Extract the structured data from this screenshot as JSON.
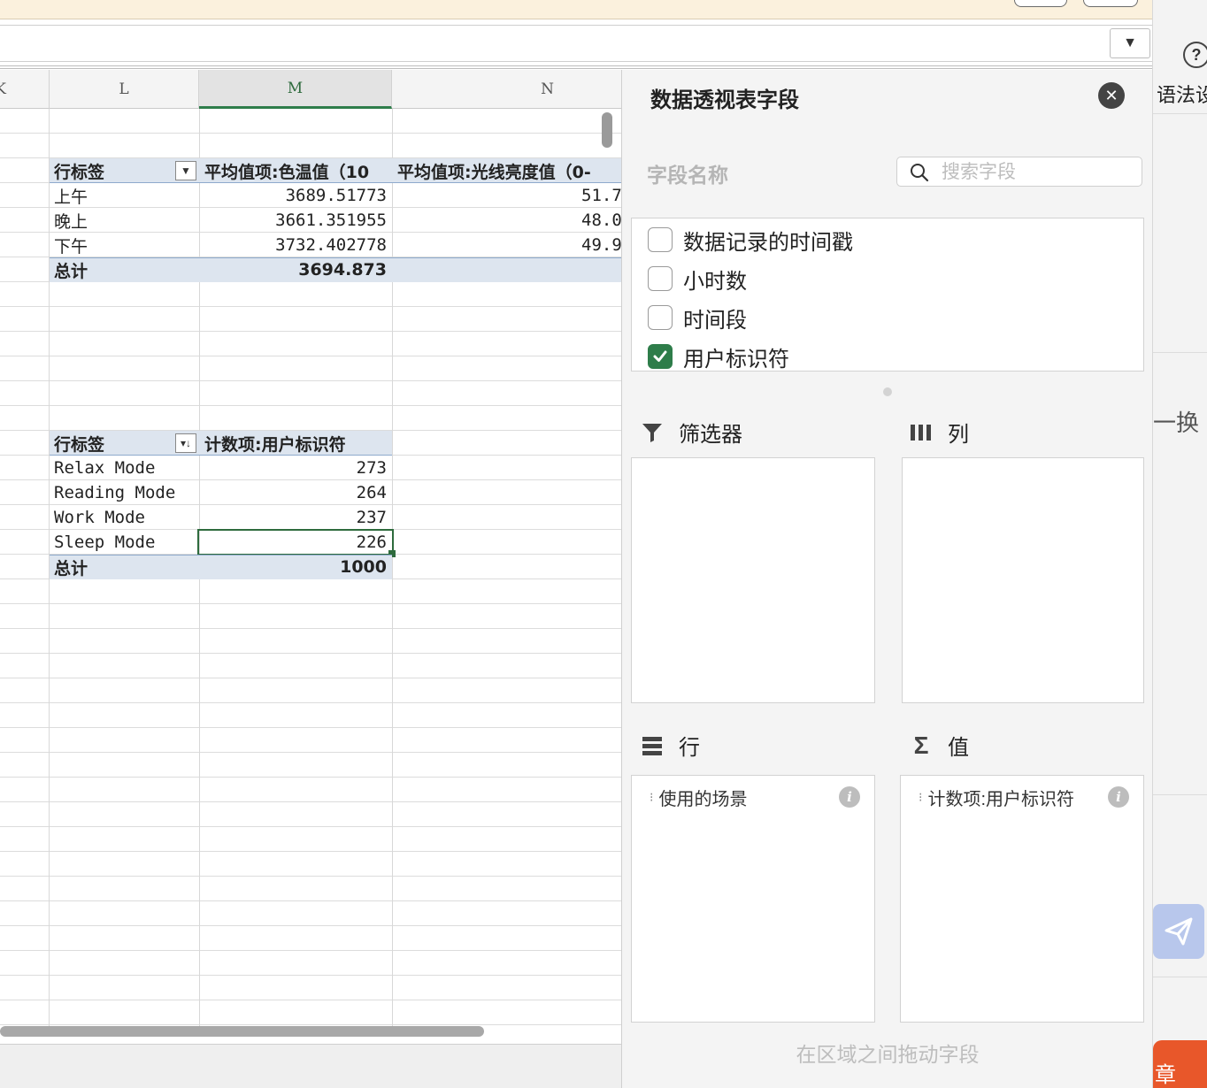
{
  "columns": [
    {
      "id": "K",
      "label": "K"
    },
    {
      "id": "L",
      "label": "L"
    },
    {
      "id": "M",
      "label": "M"
    },
    {
      "id": "N",
      "label": "N"
    }
  ],
  "pivot1": {
    "row_label_header": "行标签",
    "value_header_1": "平均值项:色温值（10",
    "value_header_2": "平均值项:光线亮度值（0-",
    "rows": [
      {
        "label": "上午",
        "v1": "3689.51773",
        "v2": "51.7"
      },
      {
        "label": "晚上",
        "v1": "3661.351955",
        "v2": "48.0"
      },
      {
        "label": "下午",
        "v1": "3732.402778",
        "v2": "49.9"
      }
    ],
    "total_label": "总计",
    "total_v1": "3694.873"
  },
  "pivot2": {
    "row_label_header": "行标签",
    "value_header": "计数项:用户标识符",
    "rows": [
      {
        "label": "Relax Mode",
        "v": "273"
      },
      {
        "label": "Reading Mode",
        "v": "264"
      },
      {
        "label": "Work Mode",
        "v": "237"
      },
      {
        "label": "Sleep Mode",
        "v": "226"
      }
    ],
    "total_label": "总计",
    "total_v": "1000"
  },
  "panel": {
    "title": "数据透视表字段",
    "field_name_label": "字段名称",
    "search_placeholder": "搜索字段",
    "fields": [
      {
        "label": "数据记录的时间戳",
        "checked": false
      },
      {
        "label": "小时数",
        "checked": false
      },
      {
        "label": "时间段",
        "checked": false
      },
      {
        "label": "用户标识符",
        "checked": true
      }
    ],
    "areas": {
      "filters_label": "筛选器",
      "columns_label": "列",
      "rows_label": "行",
      "values_label": "值",
      "rows_item": "使用的场景",
      "values_item": "计数项:用户标识符"
    },
    "drag_hint": "在区域之间拖动字段"
  },
  "right_strip": {
    "text1": "语法设",
    "text2": "一换",
    "bottom_text": "章"
  },
  "colors": {
    "accent_green": "#2e7d4a",
    "pivot_band": "#dde5ef",
    "send_button": "#b8c7ec",
    "orange_button": "#e8572a"
  }
}
